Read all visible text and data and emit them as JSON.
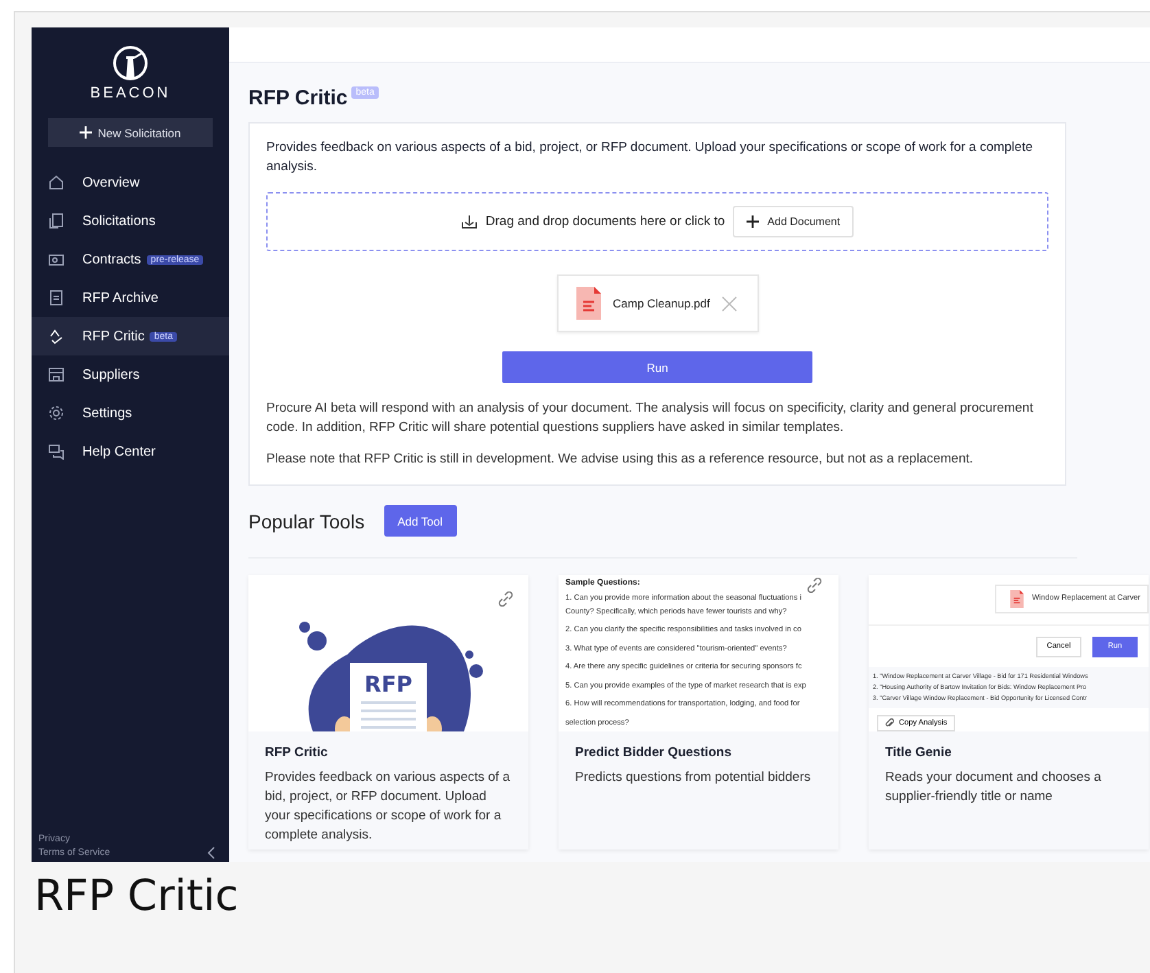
{
  "sidebar": {
    "logo": "BEACON",
    "new_button": "New Solicitation",
    "items": [
      {
        "label": "Overview",
        "selected": false
      },
      {
        "label": "Solicitations",
        "selected": false
      },
      {
        "label": "Contracts",
        "badge": "pre-release",
        "selected": false
      },
      {
        "label": "RFP Archive",
        "selected": false
      },
      {
        "label": "RFP Critic",
        "badge": "beta",
        "selected": true
      },
      {
        "label": "Suppliers",
        "selected": false
      },
      {
        "label": "Settings",
        "selected": false
      },
      {
        "label": "Help Center",
        "selected": false
      }
    ],
    "footer_links": [
      "Privacy",
      "Terms of Service"
    ]
  },
  "page": {
    "title": "RFP Critic",
    "title_badge": "beta",
    "intro": "Provides feedback on various aspects of a bid, project, or RFP document. Upload your specifications or scope of work for a complete analysis.",
    "dropzone": {
      "text": "Drag and drop documents here or click to",
      "button": "Add Document"
    },
    "file": {
      "name": "Camp Cleanup.pdf"
    },
    "run_button": "Run",
    "notes": [
      "Procure AI beta will respond with an analysis of your document. The analysis will focus on specificity, clarity and general procurement code. In addition, RFP Critic will share potential questions suppliers have asked in similar templates.",
      "Please note that RFP Critic is still in development. We advise using this as a reference resource, but not as a replacement."
    ]
  },
  "popular_tools": {
    "title": "Popular Tools",
    "add_button": "Add Tool",
    "cards": [
      {
        "kind": "illustration",
        "art_text": "RFP",
        "title": "RFP Critic",
        "description": "Provides feedback on various aspects of a bid, project, or RFP document. Upload your specifications or scope of work for a complete analysis."
      },
      {
        "kind": "questions",
        "preview_heading": "Sample Questions:",
        "questions": [
          "1. Can you provide more information about the seasonal fluctuations i",
          "County? Specifically, which periods have fewer tourists and why?",
          "2. Can you clarify the specific responsibilities and tasks involved in co",
          "3. What type of events are considered \"tourism-oriented\" events?",
          "4. Are there any specific guidelines or criteria for securing sponsors fc",
          "5. Can you provide examples of the type of market research that is exp",
          "6. How will recommendations for transportation, lodging, and food for",
          "selection process?"
        ],
        "title": "Predict Bidder Questions",
        "description": "Predicts questions from potential bidders"
      },
      {
        "kind": "titles",
        "preview_file": "Window Replacement at Carver",
        "cancel": "Cancel",
        "run": "Run",
        "results": [
          "1. \"Window Replacement at Carver Village - Bid for 171 Residential Windows",
          "2. \"Housing Authority of Bartow Invitation for Bids: Window Replacement Pro",
          "3. \"Carver Village Window Replacement - Bid Opportunity for Licensed Contr"
        ],
        "copy_button": "Copy Analysis",
        "title": "Title Genie",
        "description": "Reads your document and chooses a supplier-friendly title or name"
      }
    ]
  },
  "caption": "RFP Critic"
}
